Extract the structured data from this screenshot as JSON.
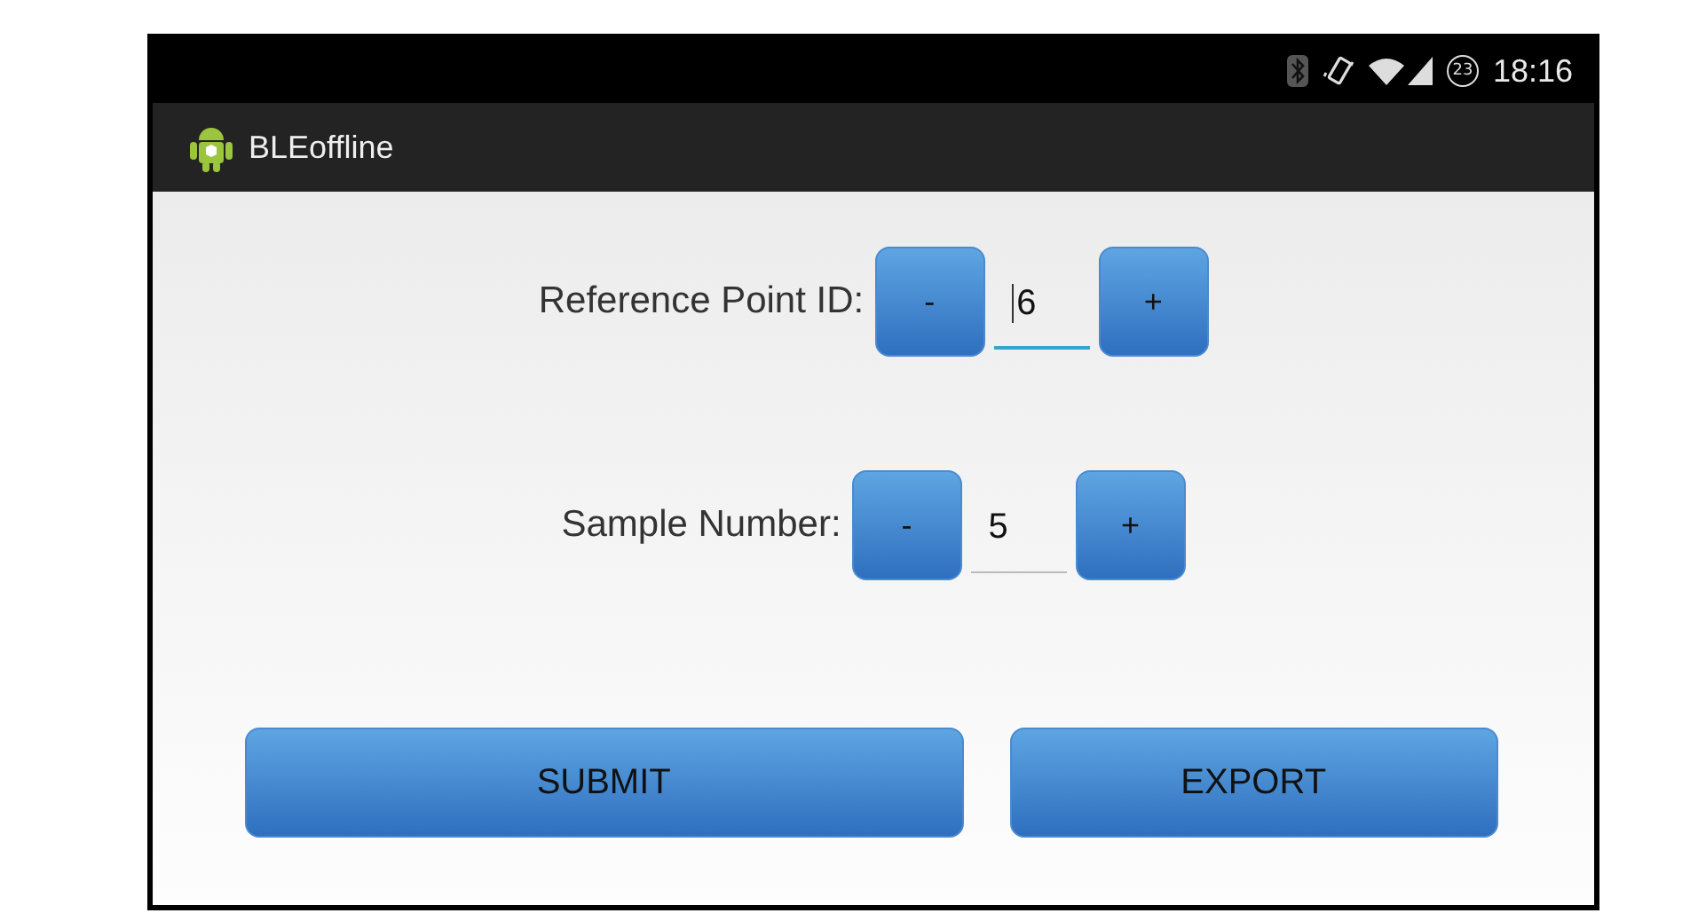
{
  "status_bar": {
    "notification_badge": "23",
    "time": "18:16"
  },
  "action_bar": {
    "title": "BLEoffline"
  },
  "steppers": [
    {
      "label": "Reference Point ID:",
      "decrement": "-",
      "value": "6",
      "increment": "+",
      "focused": true
    },
    {
      "label": "Sample Number:",
      "decrement": "-",
      "value": "5",
      "increment": "+",
      "focused": false
    }
  ],
  "buttons": [
    "SUBMIT",
    "EXPORT"
  ]
}
